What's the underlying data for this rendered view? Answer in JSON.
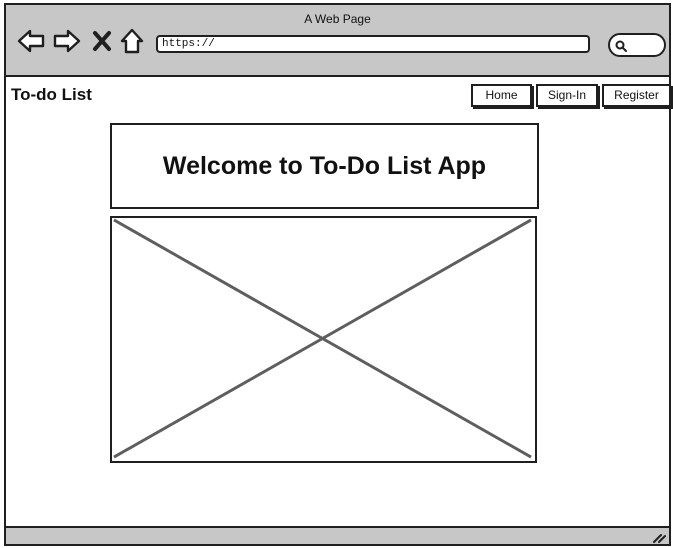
{
  "window": {
    "title": "A Web Page"
  },
  "browser": {
    "url": "https://",
    "icons": {
      "back": "back-arrow-icon",
      "forward": "forward-arrow-icon",
      "close": "close-icon",
      "home": "home-icon",
      "search": "search-icon"
    }
  },
  "app": {
    "brand": "To-do List",
    "nav": {
      "home": "Home",
      "signin": "Sign-In",
      "register": "Register"
    }
  },
  "hero": {
    "title": "Welcome to To-Do List App"
  }
}
